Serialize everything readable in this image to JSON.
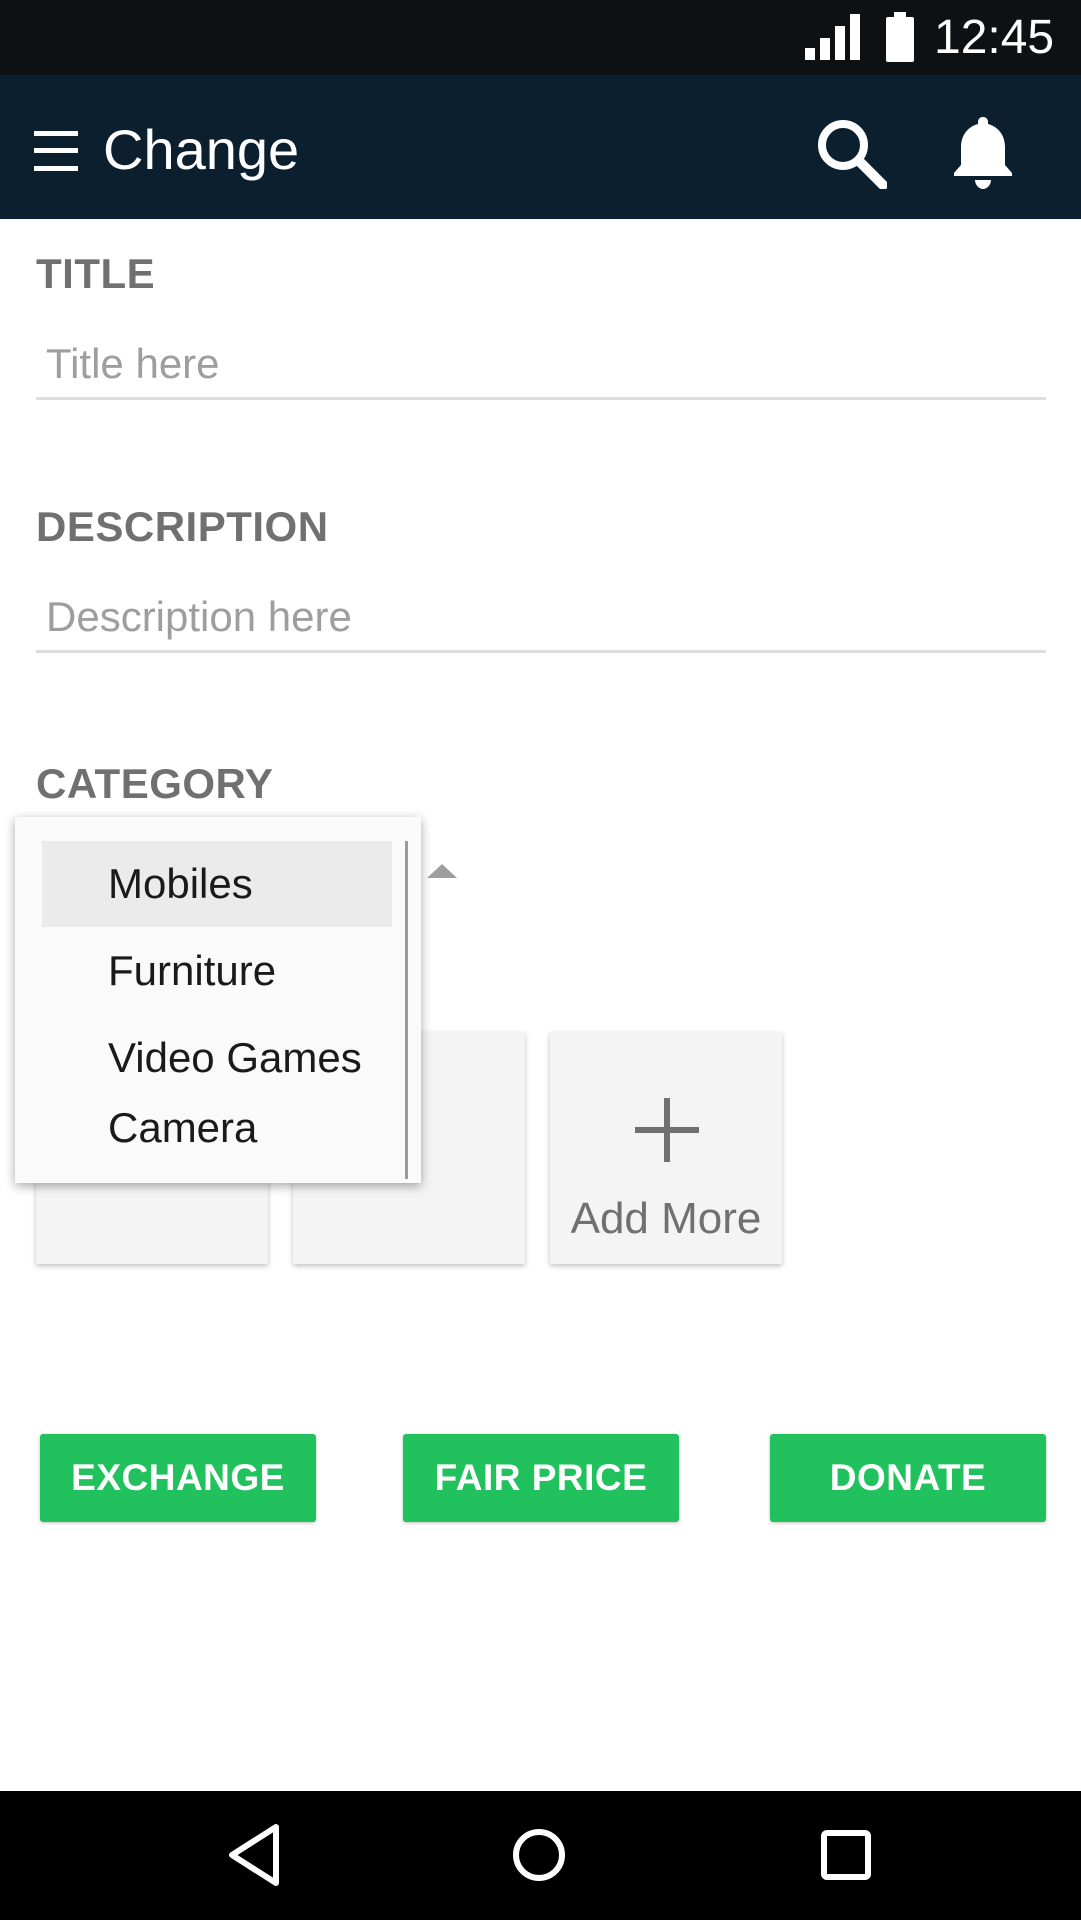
{
  "status_bar": {
    "time": "12:45"
  },
  "app_bar": {
    "title": "Change"
  },
  "form": {
    "title_label": "TITLE",
    "title_placeholder": "Title here",
    "description_label": "DESCRIPTION",
    "description_placeholder": "Description here",
    "category_label": "CATEGORY"
  },
  "category_dropdown": {
    "selected": "Mobiles",
    "options": [
      "Mobiles",
      "Furniture",
      "Video Games",
      "Camera"
    ]
  },
  "photos": {
    "add_more_label": "Add More"
  },
  "actions": {
    "exchange_label": "EXCHANGE",
    "fair_price_label": "FAIR PRICE",
    "donate_label": "DONATE"
  },
  "colors": {
    "status_bar": "#0d1114",
    "app_bar": "#0c1f2e",
    "accent_green": "#21c25e",
    "label_gray": "#707070"
  },
  "icons": [
    "signal-icon",
    "battery-icon",
    "menu-icon",
    "search-icon",
    "bell-icon",
    "plus-icon",
    "back-icon",
    "home-icon",
    "recents-icon"
  ]
}
